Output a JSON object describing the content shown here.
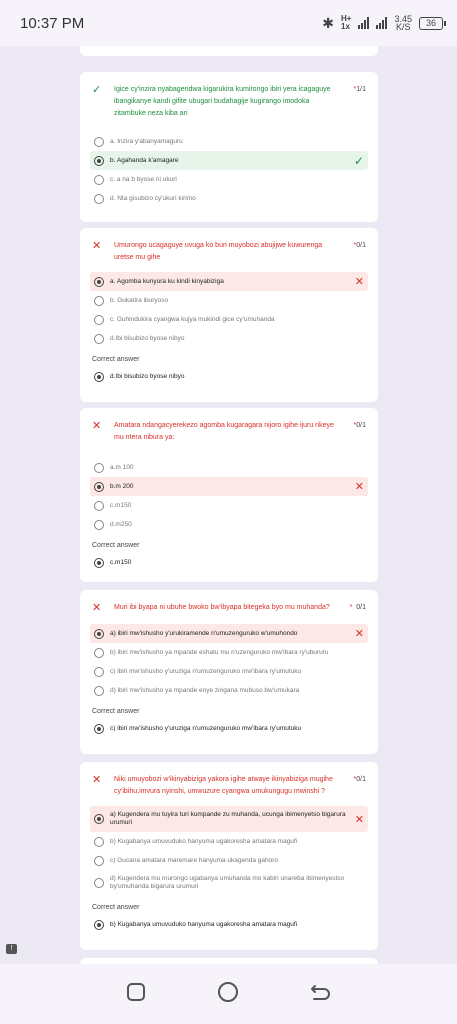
{
  "status": {
    "time": "10:37 PM",
    "network": "H+",
    "network_sub": "1x",
    "speed_value": "3.45",
    "speed_unit": "K/S",
    "battery": "36"
  },
  "labels": {
    "correct_answer": "Correct answer"
  },
  "questions": [
    {
      "status": "correct",
      "text": "Igice cy'inzira nyabagendwa kigarukira kumirongo ibiri yera icagaguye ibangikanye kandi gifite ubugari budahagije kugirango imodoka zitambuke neza kiba ari",
      "score": "1/1",
      "options": [
        {
          "label": "a. Inzira y'abanyamaguru",
          "selected": false,
          "hl": ""
        },
        {
          "label": "b. Agahanda k'amagare",
          "selected": true,
          "hl": "ok"
        },
        {
          "label": "c. a na b byose ni ukuri",
          "selected": false,
          "hl": ""
        },
        {
          "label": "d. Nta gisubizo cy'ukuri kirimo",
          "selected": false,
          "hl": ""
        }
      ]
    },
    {
      "status": "wrong",
      "text": "Umurongo ucagaguye uvuga ko buri muyobozi abujijwe kuwurenga uretse mu gihe",
      "score": "0/1",
      "options": [
        {
          "label": "a. Agomba kunyura ku kindi kinyabiziga",
          "selected": true,
          "hl": "bad"
        },
        {
          "label": "b. Gukatira iburyoso",
          "selected": false,
          "hl": ""
        },
        {
          "label": "c. Guhindukira cyangwa kujya mukindi gice cy'umuhanda",
          "selected": false,
          "hl": ""
        },
        {
          "label": "d.Ibi bisubizo byose nibyo",
          "selected": false,
          "hl": ""
        }
      ],
      "correct_answer": "d.Ibi bisubizo byose nibyo"
    },
    {
      "status": "wrong",
      "text": "Amatara ndangacyerekezo agomba kugaragara nijoro igihe ijuru rikeye mu ntera nibura ya:",
      "score": "0/1",
      "options": [
        {
          "label": "a.m 100",
          "selected": false,
          "hl": ""
        },
        {
          "label": "b.m 200",
          "selected": true,
          "hl": "bad"
        },
        {
          "label": "c.m150",
          "selected": false,
          "hl": ""
        },
        {
          "label": "d.m250",
          "selected": false,
          "hl": ""
        }
      ],
      "correct_answer": "c.m150"
    },
    {
      "status": "wrong",
      "text": "Muri ibi byapa ni ubuhe bwoko bw'ibyapa bitegeka byo mu muhanda?",
      "score": "0/1",
      "options": [
        {
          "label": "a) ibiri mw'ishusho y'urukiramende n'umuzenguruko w'umuhondo",
          "selected": true,
          "hl": "bad"
        },
        {
          "label": "b) ibiri mw'ishusho ya mpande eshatu mu n'uzenguruko mw'ibara ry'ubururu",
          "selected": false,
          "hl": ""
        },
        {
          "label": "c) ibiri mw'ishusho y'uruziga n'umuzenguruko mw'ibara ry'umutuku",
          "selected": false,
          "hl": ""
        },
        {
          "label": "d) ibiri mw'ishusho ya mpande enye zingana mubuso bw'umukara",
          "selected": false,
          "hl": ""
        }
      ],
      "correct_answer": "c) ibiri mw'ishusho y'uruziga n'umuzenguruko mw'ibara ry'umutuku"
    },
    {
      "status": "wrong",
      "text": "Niki umuyobozi w'ikinyabiziga yakora igihe atwaye ikinyabiziga mugihe cy'ibihu,imvura nyinshi, umwuzure cyangwa umukungugu mwinshi ?",
      "score": "0/1",
      "options": [
        {
          "label": "a) Kugendera mu tuyira turi kumpande zu muhanda, ucunga ibimenyetso bigarura urumuri",
          "selected": true,
          "hl": "bad",
          "two": true
        },
        {
          "label": "b) Kugabanya umuvuduko hanyuma ugakoresha amatara magufi",
          "selected": false,
          "hl": ""
        },
        {
          "label": "c) Gucana amatara maremare hanyuma ukagenda gahoro",
          "selected": false,
          "hl": ""
        },
        {
          "label": "d) Kugendera mu murongo ugabanya umuhanda mo kabiri unareba ibimenyestso by'umuhanda bigarura urumuri",
          "selected": false,
          "hl": "",
          "two": true
        }
      ],
      "correct_answer": "b) Kugabanya umuvuduko hanyuma ugakoresha amatara magufi"
    }
  ]
}
